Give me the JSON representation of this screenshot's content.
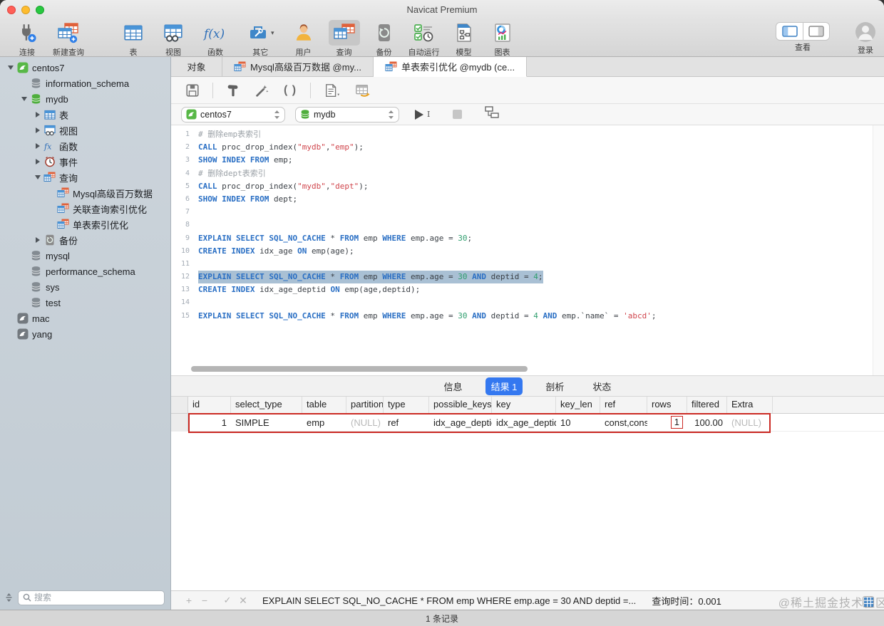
{
  "window": {
    "title": "Navicat Premium"
  },
  "toolbar": {
    "items": [
      {
        "name": "connect",
        "label": "连接",
        "icon": "connect"
      },
      {
        "name": "new-query",
        "label": "新建查询",
        "icon": "newquery"
      },
      {
        "name": "table",
        "label": "表",
        "icon": "table",
        "gap": true
      },
      {
        "name": "view",
        "label": "视图",
        "icon": "view"
      },
      {
        "name": "function",
        "label": "函数",
        "icon": "function"
      },
      {
        "name": "other",
        "label": "其它",
        "icon": "other",
        "chevron": true
      },
      {
        "name": "user",
        "label": "用户",
        "icon": "user"
      },
      {
        "name": "query",
        "label": "查询",
        "icon": "query",
        "active": true
      },
      {
        "name": "backup",
        "label": "备份",
        "icon": "backup"
      },
      {
        "name": "autorun",
        "label": "自动运行",
        "icon": "autorun"
      },
      {
        "name": "model",
        "label": "模型",
        "icon": "model"
      },
      {
        "name": "charts",
        "label": "图表",
        "icon": "chart"
      }
    ],
    "view_label": "查看",
    "login_label": "登录"
  },
  "sidebar": {
    "search_placeholder": "搜索",
    "items": [
      {
        "label": "centos7",
        "level": 0,
        "arrow": "down",
        "icon": "conn-green"
      },
      {
        "label": "information_schema",
        "level": 1,
        "arrow": "none",
        "icon": "db-gray"
      },
      {
        "label": "mydb",
        "level": 1,
        "arrow": "down",
        "icon": "db-green"
      },
      {
        "label": "表",
        "level": 2,
        "arrow": "right",
        "icon": "table"
      },
      {
        "label": "视图",
        "level": 2,
        "arrow": "right",
        "icon": "view"
      },
      {
        "label": "函数",
        "level": 2,
        "arrow": "right",
        "icon": "fx"
      },
      {
        "label": "事件",
        "level": 2,
        "arrow": "right",
        "icon": "event"
      },
      {
        "label": "查询",
        "level": 2,
        "arrow": "down",
        "icon": "query"
      },
      {
        "label": "Mysql高级百万数据",
        "level": 3,
        "arrow": "none",
        "icon": "query"
      },
      {
        "label": "关联查询索引优化",
        "level": 3,
        "arrow": "none",
        "icon": "query"
      },
      {
        "label": "单表索引优化",
        "level": 3,
        "arrow": "none",
        "icon": "query"
      },
      {
        "label": "备份",
        "level": 2,
        "arrow": "right",
        "icon": "backup"
      },
      {
        "label": "mysql",
        "level": 1,
        "arrow": "none",
        "icon": "db-gray"
      },
      {
        "label": "performance_schema",
        "level": 1,
        "arrow": "none",
        "icon": "db-gray"
      },
      {
        "label": "sys",
        "level": 1,
        "arrow": "none",
        "icon": "db-gray"
      },
      {
        "label": "test",
        "level": 1,
        "arrow": "none",
        "icon": "db-gray"
      },
      {
        "label": "mac",
        "level": 0,
        "arrow": "none",
        "icon": "conn-gray"
      },
      {
        "label": "yang",
        "level": 0,
        "arrow": "none",
        "icon": "conn-gray"
      }
    ]
  },
  "tabs": [
    {
      "name": "objects",
      "label": "对象"
    },
    {
      "name": "query-tab-1",
      "label": "Mysql高级百万数据 @my...",
      "icon": "query"
    },
    {
      "name": "query-tab-2",
      "label": "单表索引优化 @mydb (ce...",
      "icon": "query",
      "active": true
    }
  ],
  "query_bar": {
    "connection": "centos7",
    "database": "mydb"
  },
  "editor": {
    "lines": [
      {
        "tokens": [
          [
            "c",
            "# 删除emp表索引"
          ]
        ]
      },
      {
        "tokens": [
          [
            "k",
            "CALL"
          ],
          [
            "p",
            " proc_drop_index("
          ],
          [
            "s",
            "\"mydb\""
          ],
          [
            "p",
            ","
          ],
          [
            "s",
            "\"emp\""
          ],
          [
            "p",
            ");"
          ]
        ]
      },
      {
        "tokens": [
          [
            "k",
            "SHOW INDEX FROM"
          ],
          [
            "p",
            " emp;"
          ]
        ]
      },
      {
        "tokens": [
          [
            "c",
            "# 删除dept表索引"
          ]
        ]
      },
      {
        "tokens": [
          [
            "k",
            "CALL"
          ],
          [
            "p",
            " proc_drop_index("
          ],
          [
            "s",
            "\"mydb\""
          ],
          [
            "p",
            ","
          ],
          [
            "s",
            "\"dept\""
          ],
          [
            "p",
            ");"
          ]
        ]
      },
      {
        "tokens": [
          [
            "k",
            "SHOW INDEX FROM"
          ],
          [
            "p",
            " dept;"
          ]
        ]
      },
      {
        "tokens": []
      },
      {
        "tokens": []
      },
      {
        "tokens": [
          [
            "k",
            "EXPLAIN SELECT SQL_NO_CACHE"
          ],
          [
            "p",
            " * "
          ],
          [
            "k",
            "FROM"
          ],
          [
            "p",
            " emp "
          ],
          [
            "k",
            "WHERE"
          ],
          [
            "p",
            " emp.age = "
          ],
          [
            "n",
            "30"
          ],
          [
            "p",
            ";"
          ]
        ]
      },
      {
        "tokens": [
          [
            "k",
            "CREATE INDEX"
          ],
          [
            "p",
            " idx_age "
          ],
          [
            "k",
            "ON"
          ],
          [
            "p",
            " emp(age);"
          ]
        ]
      },
      {
        "tokens": []
      },
      {
        "sel": true,
        "tokens": [
          [
            "k",
            "EXPLAIN SELECT SQL_NO_CACHE"
          ],
          [
            "p",
            " * "
          ],
          [
            "k",
            "FROM"
          ],
          [
            "p",
            " emp "
          ],
          [
            "k",
            "WHERE"
          ],
          [
            "p",
            " emp.age = "
          ],
          [
            "n",
            "30"
          ],
          [
            "p",
            " "
          ],
          [
            "k",
            "AND"
          ],
          [
            "p",
            " deptid = "
          ],
          [
            "n",
            "4"
          ],
          [
            "p",
            ";"
          ]
        ]
      },
      {
        "tokens": [
          [
            "k",
            "CREATE INDEX"
          ],
          [
            "p",
            " idx_age_deptid "
          ],
          [
            "k",
            "ON"
          ],
          [
            "p",
            " emp(age,deptid);"
          ]
        ]
      },
      {
        "tokens": []
      },
      {
        "tokens": [
          [
            "k",
            "EXPLAIN SELECT SQL_NO_CACHE"
          ],
          [
            "p",
            " * "
          ],
          [
            "k",
            "FROM"
          ],
          [
            "p",
            " emp "
          ],
          [
            "k",
            "WHERE"
          ],
          [
            "p",
            " emp.age = "
          ],
          [
            "n",
            "30"
          ],
          [
            "p",
            " "
          ],
          [
            "k",
            "AND"
          ],
          [
            "p",
            " deptid = "
          ],
          [
            "n",
            "4"
          ],
          [
            "p",
            " "
          ],
          [
            "k",
            "AND"
          ],
          [
            "p",
            " emp.`name` = "
          ],
          [
            "s",
            "'abcd'"
          ],
          [
            "p",
            ";"
          ]
        ]
      }
    ]
  },
  "result_panel": {
    "tabs": [
      {
        "label": "信息"
      },
      {
        "label": "结果 1",
        "active": true
      },
      {
        "label": "剖析"
      },
      {
        "label": "状态"
      }
    ],
    "columns": [
      "id",
      "select_type",
      "table",
      "partitions",
      "type",
      "possible_keys",
      "key",
      "key_len",
      "ref",
      "rows",
      "filtered",
      "Extra"
    ],
    "row": [
      "1",
      "SIMPLE",
      "emp",
      "(NULL)",
      "ref",
      "idx_age_deptid",
      "idx_age_deptid",
      "10",
      "const,const",
      "1",
      "100.00",
      "(NULL)"
    ]
  },
  "footer": {
    "statement": "EXPLAIN SELECT SQL_NO_CACHE * FROM emp WHERE emp.age = 30 AND deptid =...",
    "time": "查询时间：0.001",
    "watermark": "@稀土掘金技术社区"
  },
  "statusbar": {
    "records": "1 条记录"
  }
}
